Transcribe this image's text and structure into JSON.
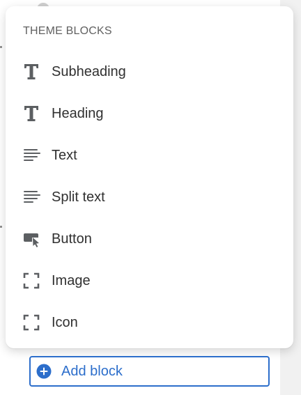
{
  "menu": {
    "heading": "THEME BLOCKS",
    "items": [
      {
        "label": "Subheading",
        "icon": "text-t-icon"
      },
      {
        "label": "Heading",
        "icon": "text-t-icon"
      },
      {
        "label": "Text",
        "icon": "text-align-left-icon"
      },
      {
        "label": "Split text",
        "icon": "text-align-left-icon"
      },
      {
        "label": "Button",
        "icon": "button-press-icon"
      },
      {
        "label": "Image",
        "icon": "image-frame-icon"
      },
      {
        "label": "Icon",
        "icon": "image-frame-icon"
      }
    ]
  },
  "footer": {
    "add_block_label": "Add block",
    "accent_color": "#2c6ecb"
  }
}
